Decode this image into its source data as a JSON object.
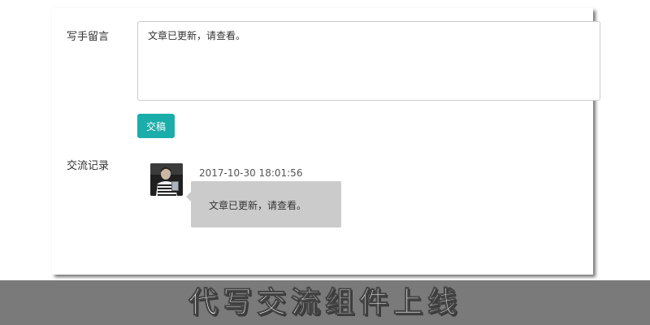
{
  "form": {
    "message_label": "写手留言",
    "message_value": "文章已更新，请查看。",
    "submit_label": "交稿"
  },
  "history": {
    "label": "交流记录",
    "entries": [
      {
        "avatar": "user-avatar-photo",
        "timestamp": "2017-10-30 18:01:56",
        "message": "文章已更新，请查看。"
      }
    ]
  },
  "banner": {
    "title": "代写交流组件上线"
  }
}
